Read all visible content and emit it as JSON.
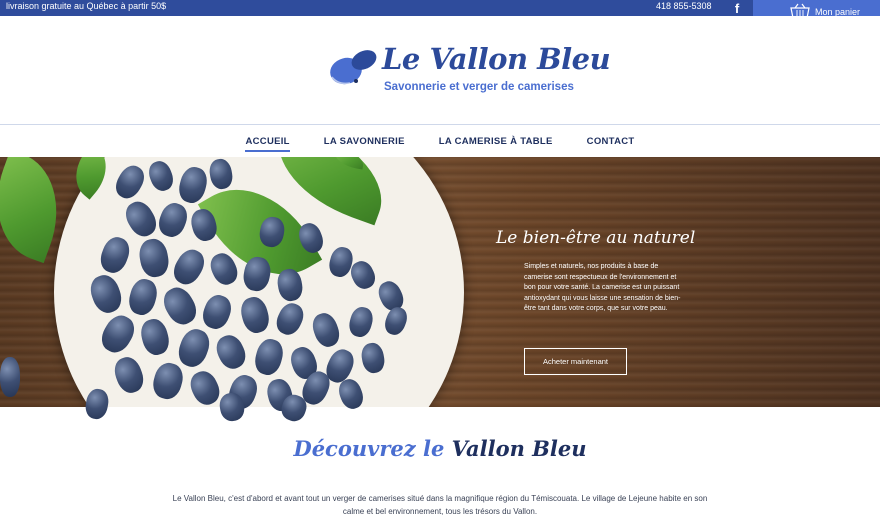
{
  "topbar": {
    "promo": "livraison gratuite au Québec à partir 50$",
    "phone": "418 855-5308",
    "facebook_icon": "facebook-icon",
    "cart_label": "Mon panier",
    "cart_icon": "basket-icon"
  },
  "header": {
    "brand": "Le Vallon Bleu",
    "tagline": "Savonnerie et verger de camerises"
  },
  "nav": {
    "items": [
      {
        "label": "ACCUEIL",
        "active": true
      },
      {
        "label": "LA SAVONNERIE",
        "active": false
      },
      {
        "label": "LA CAMERISE À TABLE",
        "active": false
      },
      {
        "label": "CONTACT",
        "active": false
      }
    ]
  },
  "hero": {
    "title": "Le bien-être au naturel",
    "text": "Simples et naturels, nos produits à base de camerise sont respectueux de l'environnement et bon pour votre santé. La camerise est un puissant antioxydant qui vous laisse une sensation de bien-être tant dans votre corps, que sur votre peau.",
    "button": "Acheter maintenant"
  },
  "discover": {
    "title_part1": "Découvrez le",
    "title_part2": "Vallon Bleu",
    "text": "Le Vallon Bleu, c'est d'abord et avant tout un verger de camerises situé dans la magnifique région du Témiscouata. Le village de Lejeune habite en son calme et bel environnement, tous les trésors du Vallon."
  },
  "colors": {
    "topbar": "#2f4c9c",
    "accent": "#4a6ed0",
    "dark_blue": "#1e2f5e"
  }
}
